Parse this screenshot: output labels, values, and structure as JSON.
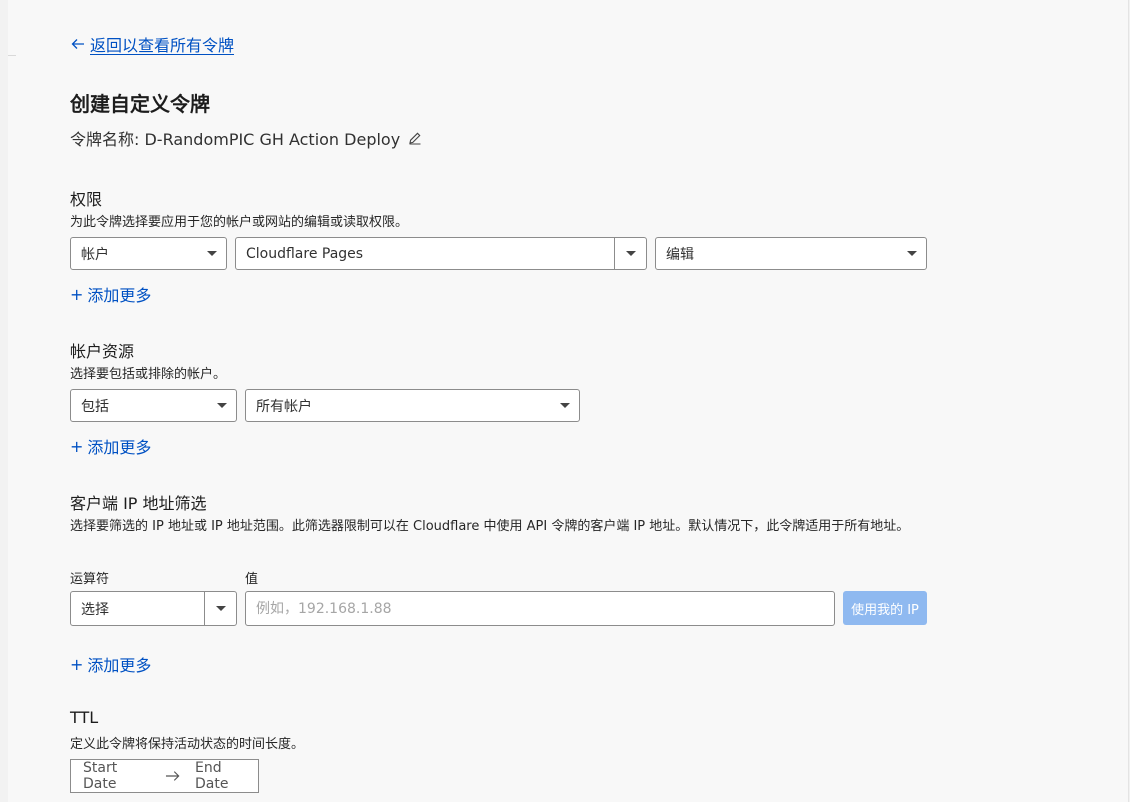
{
  "back_link": {
    "label": "返回以查看所有令牌"
  },
  "page_title": "创建自定义令牌",
  "token_name": {
    "label": "令牌名称: D-RandomPIC GH Action Deploy"
  },
  "permissions": {
    "title": "权限",
    "description": "为此令牌选择要应用于您的帐户或网站的编辑或读取权限。",
    "scope": "帐户",
    "resource": "Cloudflare Pages",
    "access": "编辑",
    "add_more": "添加更多"
  },
  "account_resources": {
    "title": "帐户资源",
    "description": "选择要包括或排除的帐户。",
    "mode": "包括",
    "target": "所有帐户",
    "add_more": "添加更多"
  },
  "ip_filter": {
    "title": "客户端 IP 地址筛选",
    "description": "选择要筛选的 IP 地址或 IP 地址范围。此筛选器限制可以在 Cloudflare 中使用 API 令牌的客户端 IP 地址。默认情况下，此令牌适用于所有地址。",
    "operator_label": "运算符",
    "value_label": "值",
    "operator_value": "选择",
    "value_placeholder": "例如，192.168.1.88",
    "use_my_ip": "使用我的 IP",
    "add_more": "添加更多"
  },
  "ttl": {
    "title": "TTL",
    "description": "定义此令牌将保持活动状态的时间长度。",
    "start_date": "Start Date",
    "end_date": "End Date"
  },
  "icons": {
    "back": "arrow-left-icon",
    "edit": "pencil-icon",
    "add": "plus-icon",
    "range": "arrow-right-icon",
    "dropdown": "caret-down-icon"
  },
  "colors": {
    "link": "#0051c3",
    "button_disabled": "#8fb9f0",
    "background": "#f8f8f8"
  }
}
